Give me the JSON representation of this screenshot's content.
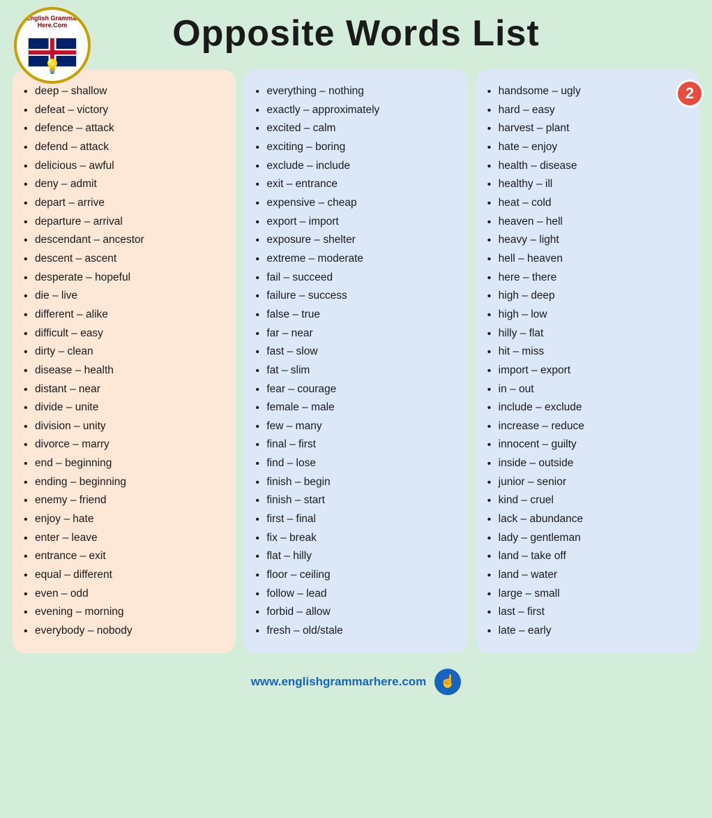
{
  "header": {
    "title": "Opposite Words List"
  },
  "footer": {
    "url": "www.englishgrammarhere.com"
  },
  "badge": "2",
  "columns": [
    {
      "id": "col1",
      "items": [
        "deep – shallow",
        "defeat – victory",
        "defence – attack",
        "defend – attack",
        "delicious – awful",
        "deny – admit",
        "depart – arrive",
        "departure – arrival",
        "descendant – ancestor",
        "descent – ascent",
        "desperate – hopeful",
        "die – live",
        "different – alike",
        "difficult – easy",
        "dirty – clean",
        "disease – health",
        "distant – near",
        "divide – unite",
        "division – unity",
        "divorce – marry",
        "end – beginning",
        "ending – beginning",
        "enemy – friend",
        "enjoy – hate",
        "enter – leave",
        "entrance – exit",
        "equal – different",
        "even – odd",
        "evening – morning",
        "everybody – nobody"
      ]
    },
    {
      "id": "col2",
      "items": [
        "everything – nothing",
        "exactly – approximately",
        "excited – calm",
        "exciting – boring",
        "exclude – include",
        "exit – entrance",
        "expensive – cheap",
        "export – import",
        "exposure – shelter",
        "extreme – moderate",
        "fail – succeed",
        "failure – success",
        "false – true",
        "far – near",
        "fast – slow",
        "fat – slim",
        "fear – courage",
        "female – male",
        "few – many",
        "final – first",
        "find – lose",
        "finish – begin",
        "finish – start",
        "first – final",
        "fix – break",
        "flat – hilly",
        "floor – ceiling",
        "follow – lead",
        "forbid – allow",
        "fresh – old/stale"
      ]
    },
    {
      "id": "col3",
      "items": [
        "handsome – ugly",
        "hard – easy",
        "harvest – plant",
        "hate – enjoy",
        "health – disease",
        "healthy – ill",
        "heat – cold",
        "heaven – hell",
        "heavy – light",
        "hell – heaven",
        "here – there",
        "high – deep",
        "high – low",
        "hilly – flat",
        "hit – miss",
        "import – export",
        "in – out",
        "include – exclude",
        "increase – reduce",
        "innocent – guilty",
        "inside – outside",
        "junior – senior",
        "kind – cruel",
        "lack – abundance",
        "lady – gentleman",
        "land – take off",
        "land – water",
        "large – small",
        "last – first",
        "late – early"
      ]
    }
  ]
}
